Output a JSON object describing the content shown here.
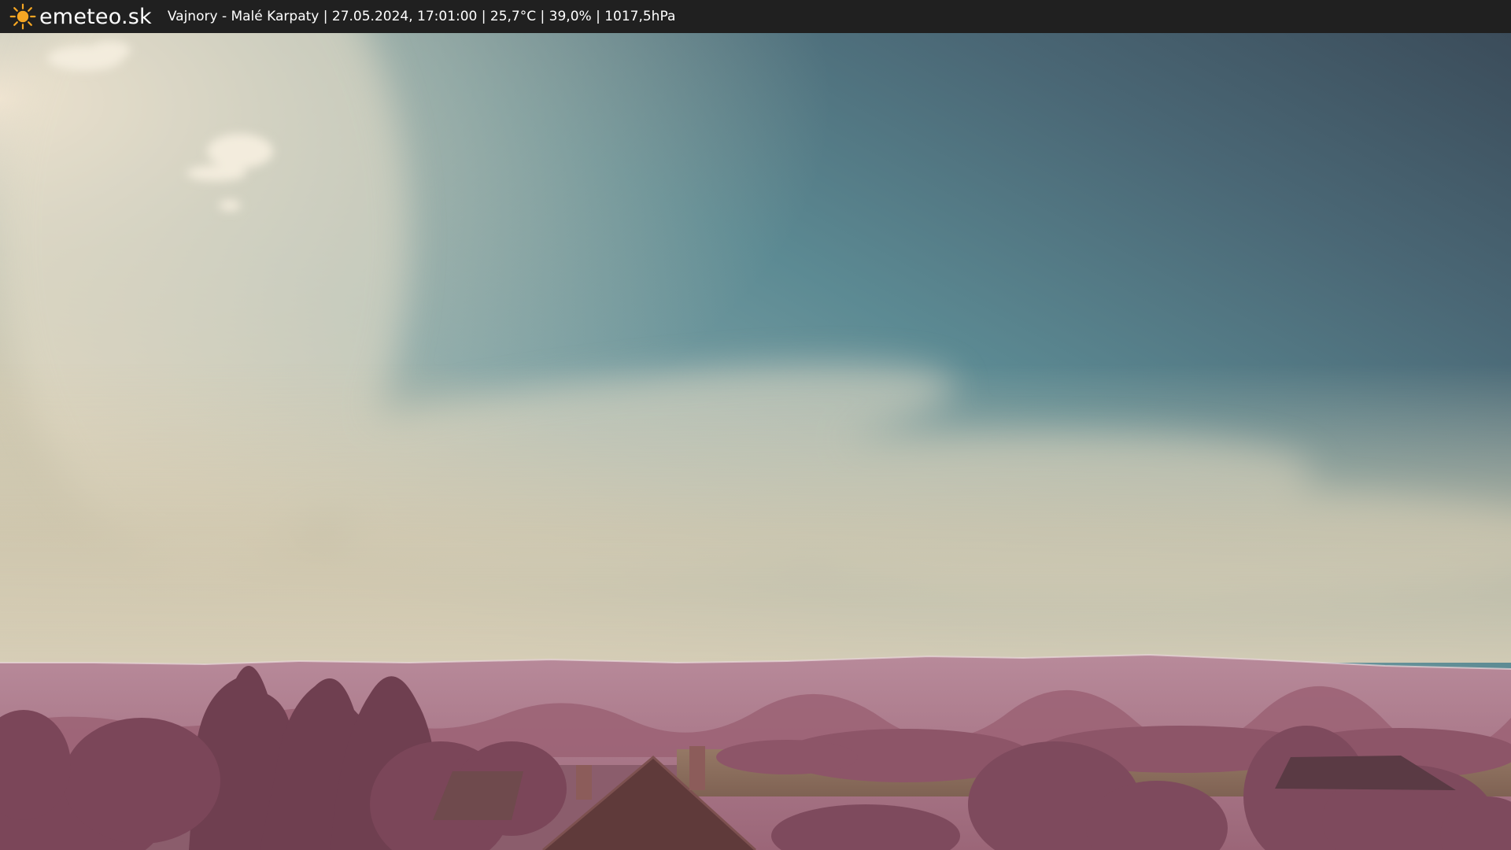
{
  "brand": {
    "name": "emeteo.sk",
    "icon": "sun-icon",
    "accent_color": "#f5a623"
  },
  "caption": {
    "text": "Vajnory - Malé Karpaty | 27.05.2024, 17:01:00 | 25,7°C | 39,0% | 1017,5hPa"
  },
  "scene": {
    "description_colors": {
      "sky_top_right": "#3c5060",
      "sky_mid": "#5a8a94",
      "haze": "#cfc6ae",
      "hills": "#b0788c",
      "trees": "#7a4656",
      "field": "#8c6e5c"
    }
  }
}
